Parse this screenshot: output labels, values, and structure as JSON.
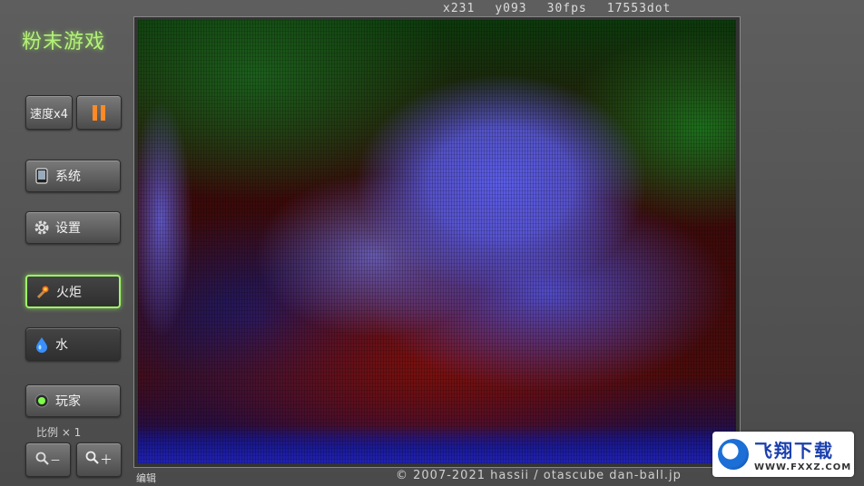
{
  "app": {
    "title": "粉末游戏"
  },
  "status": {
    "x": "x231",
    "y": "y093",
    "fps": "30fps",
    "dots": "17553dot"
  },
  "controls": {
    "speed_label": "速度x4",
    "system_label": "系统",
    "settings_label": "设置",
    "torch_label": "火炬",
    "water_label": "水",
    "player_label": "玩家",
    "scale_label": "比例 × 1",
    "zoom_out_label": "－",
    "zoom_in_label": "＋"
  },
  "footer": {
    "edit_label": "编辑",
    "copyright": "© 2007-2021 hassii / otascube dan-ball.jp"
  },
  "watermark": {
    "brand": "飞翔下载",
    "url": "WWW.FXXZ.COM"
  },
  "colors": {
    "accent": "#9ef46a",
    "pause": "#ff8a25",
    "title": "#b6f07a"
  }
}
